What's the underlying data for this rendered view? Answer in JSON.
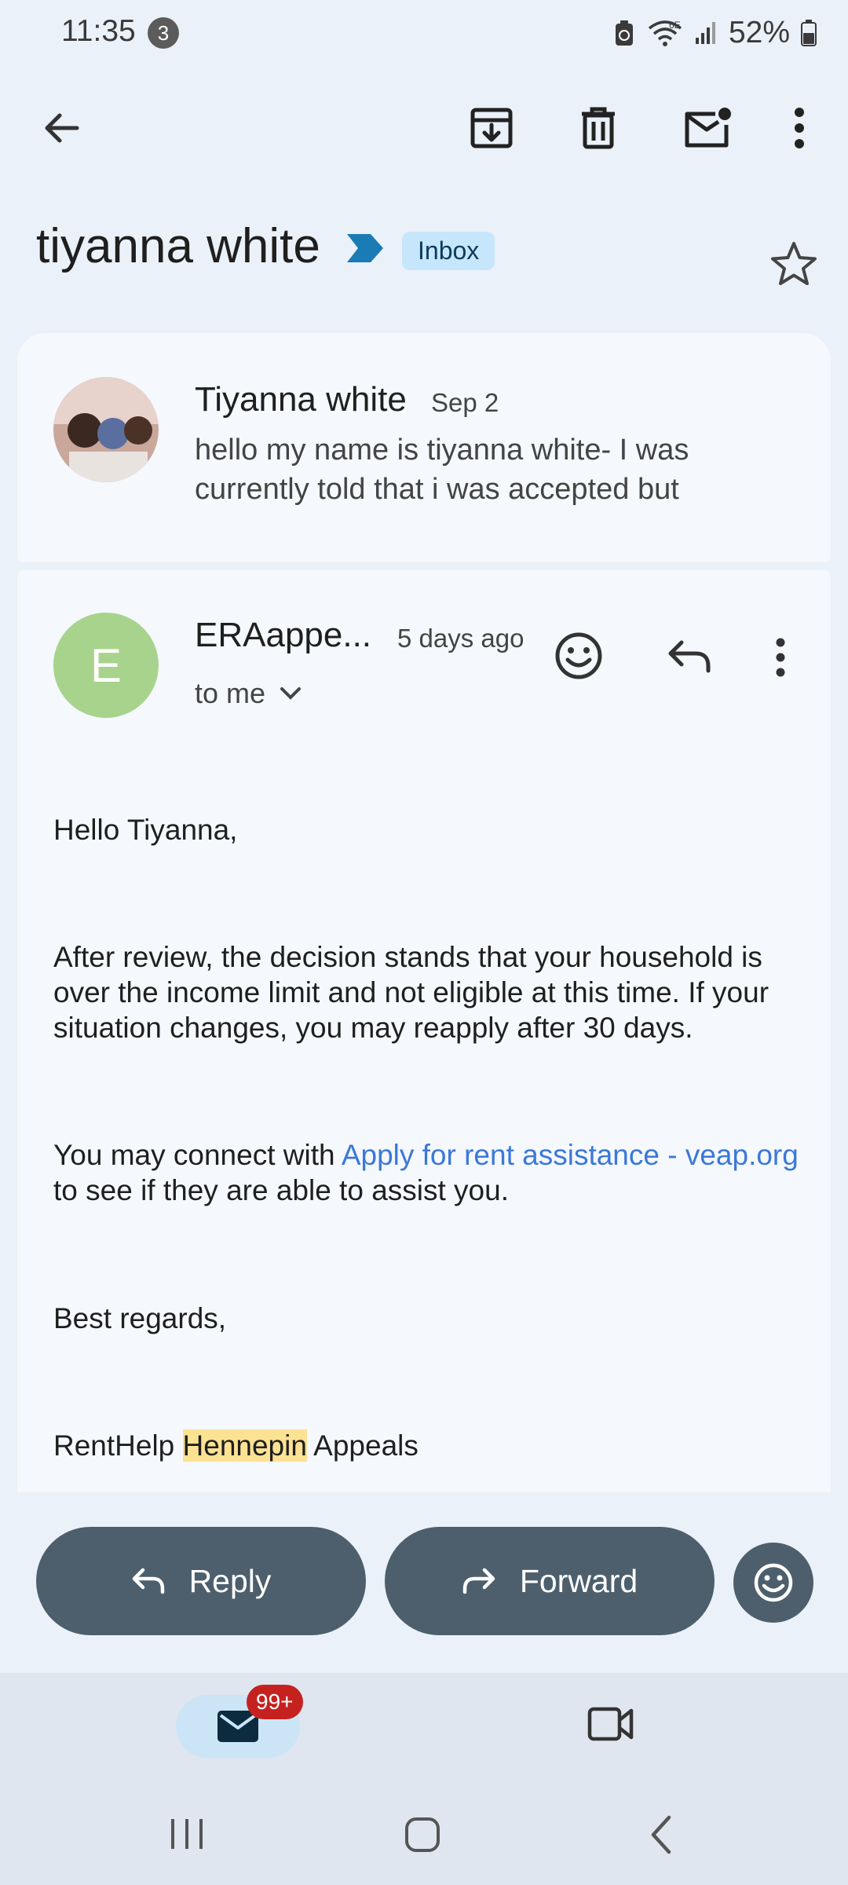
{
  "status_bar": {
    "time": "11:35",
    "notification_count": "3",
    "battery": "52%",
    "network": "6E"
  },
  "toolbar": {
    "icons": [
      "back-arrow-icon",
      "archive-icon",
      "delete-icon",
      "mark-unread-icon",
      "more-vert-icon"
    ]
  },
  "subject": {
    "title": "tiyanna white",
    "label": "Inbox"
  },
  "messages": [
    {
      "sender": "Tiyanna white",
      "date": "Sep 2",
      "snippet": "hello my name is tiyanna white- I was currently told that i was accepted but"
    },
    {
      "sender": "ERAappe...",
      "avatar_letter": "E",
      "date": "5 days ago",
      "recipient": "to me",
      "body": {
        "greeting": "Hello Tiyanna,",
        "paragraph1": "After review, the decision stands that your household is over the income limit and not eligible at this time. If your situation changes, you may reapply after 30 days.",
        "p2_before": "You may connect with ",
        "p2_link": "Apply for rent assistance - veap.org",
        "p2_after": " to see if they are able to assist you.",
        "closing": "Best regards,",
        "sig_before": "RentHelp ",
        "sig_highlight": "Hennepin",
        "sig_after": " Appeals"
      }
    }
  ],
  "actions": {
    "reply": "Reply",
    "forward": "Forward"
  },
  "bottom_nav": {
    "mail_badge": "99+"
  },
  "colors": {
    "background": "#ebf1f9",
    "card": "#f5f8fd",
    "action_button": "#4d5f6c",
    "link": "#3b78d8",
    "highlight": "#fde293",
    "badge": "#c5221f",
    "avatar_e": "#a8d38c"
  }
}
